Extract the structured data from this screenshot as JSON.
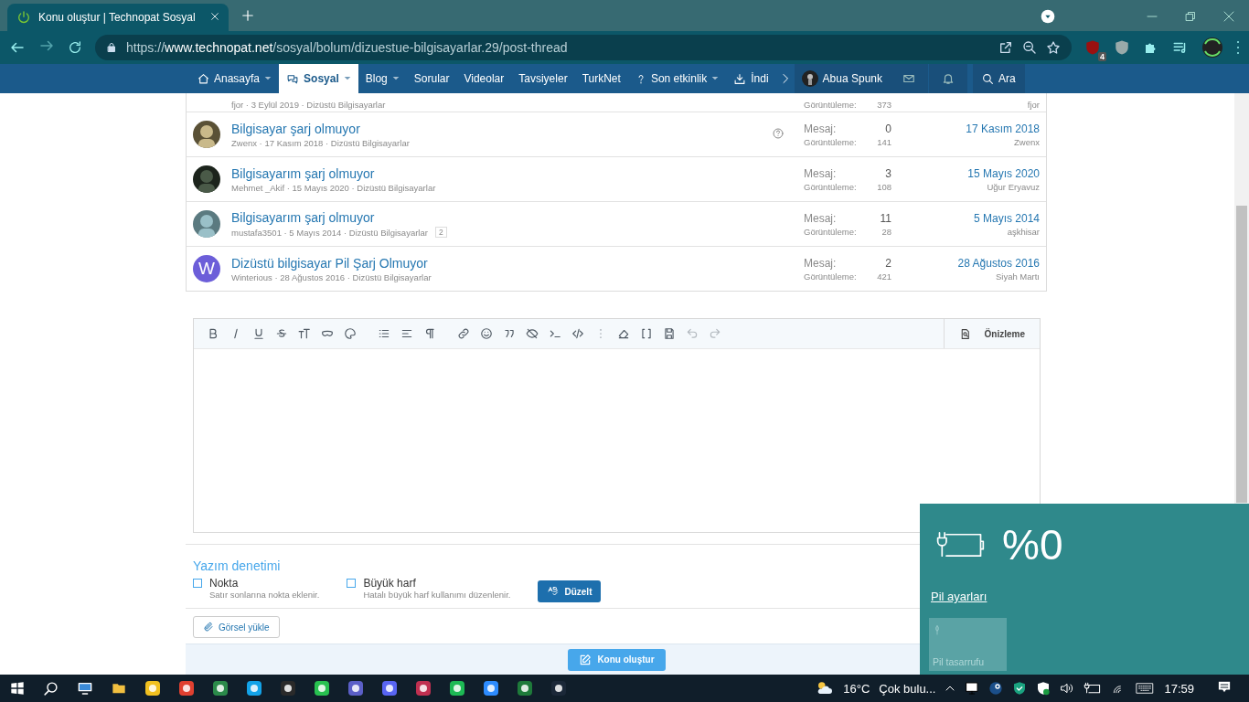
{
  "browser": {
    "tab_title": "Konu oluştur | Technopat Sosyal",
    "url": "https://**www.technopat.net**/sosyal/bolum/dizuestue-bilgisayarlar.29/post-thread",
    "extension_badge": "4"
  },
  "nav": {
    "items": [
      {
        "label": "Anasayfa",
        "selected": false,
        "kind": "home",
        "caret": true
      },
      {
        "label": "Sosyal",
        "selected": true,
        "kind": "chat",
        "caret": true
      },
      {
        "label": "Blog",
        "selected": false,
        "kind": "plain",
        "caret": true
      },
      {
        "label": "Sorular",
        "selected": false,
        "kind": "plain",
        "caret": false
      },
      {
        "label": "Videolar",
        "selected": false,
        "kind": "plain",
        "caret": false
      },
      {
        "label": "Tavsiyeler",
        "selected": false,
        "kind": "plain",
        "caret": false
      },
      {
        "label": "TurkNet",
        "selected": false,
        "kind": "plain",
        "caret": false
      },
      {
        "label": "Son etkinlik",
        "selected": false,
        "kind": "activity",
        "caret": true
      },
      {
        "label": "İndi",
        "selected": false,
        "kind": "download",
        "caret": false
      }
    ],
    "user": "Abua Spunk",
    "search": "Ara"
  },
  "threads": [
    {
      "meta": "fjor · 3 Eylül 2019 · Dizüstü Bilgisayarlar",
      "views_label": "Görüntüleme:",
      "views": "373",
      "last_user": "fjor",
      "kind": "partial"
    },
    {
      "title": "Bilgisayar şarj olmuyor",
      "meta": "Zwenx · 17 Kasım 2018 · Dizüstü Bilgisayarlar",
      "replies_label": "Mesaj:",
      "replies": "0",
      "views_label": "Görüntüleme:",
      "views": "141",
      "last_date": "17 Kasım 2018",
      "last_user": "Zwenx",
      "kind": "question"
    },
    {
      "title": "Bilgisayarım şarj olmuyor",
      "meta": "Mehmet _Akif · 15 Mayıs 2020 · Dizüstü Bilgisayarlar",
      "replies_label": "Mesaj:",
      "replies": "3",
      "views_label": "Görüntüleme:",
      "views": "108",
      "last_date": "15 Mayıs 2020",
      "last_user": "Uğur Eryavuz",
      "kind": "normal"
    },
    {
      "title": "Bilgisayarım şarj olmuyor",
      "meta": "mustafa3501 · 5 Mayıs 2014 · Dizüstü Bilgisayarlar",
      "pages": "2",
      "replies_label": "Mesaj:",
      "replies": "11",
      "views_label": "Görüntüleme:",
      "views": "28",
      "last_date": "5 Mayıs 2014",
      "last_user": "aşkhisar",
      "kind": "normal"
    },
    {
      "title": "Dizüstü bilgisayar Pil Şarj Olmuyor",
      "meta": "Winterious · 28 Ağustos 2016 · Dizüstü Bilgisayarlar",
      "avatar_letter": "W",
      "replies_label": "Mesaj:",
      "replies": "2",
      "views_label": "Görüntüleme:",
      "views": "421",
      "last_date": "28 Ağustos 2016",
      "last_user": "Siyah Martı",
      "kind": "letter"
    }
  ],
  "editor": {
    "preview": "Önizleme"
  },
  "spellcheck": {
    "title": "Yazım denetimi",
    "options": [
      {
        "label": "Nokta",
        "hint": "Satır sonlarına nokta eklenir.",
        "checked": false
      },
      {
        "label": "Büyük harf",
        "hint": "Hatalı büyük harf kullanımı düzenlenir.",
        "checked": false
      }
    ],
    "button": "Düzelt"
  },
  "upload": "Görsel yükle",
  "submit": "Konu oluştur",
  "battery": {
    "percent": "%0",
    "settings_link": "Pil ayarları",
    "saver": {
      "label": "Pil tasarrufu",
      "on": false
    }
  },
  "taskbar": {
    "temperature": "16°C",
    "weather": "Çok bulu...",
    "time": "17:59"
  }
}
